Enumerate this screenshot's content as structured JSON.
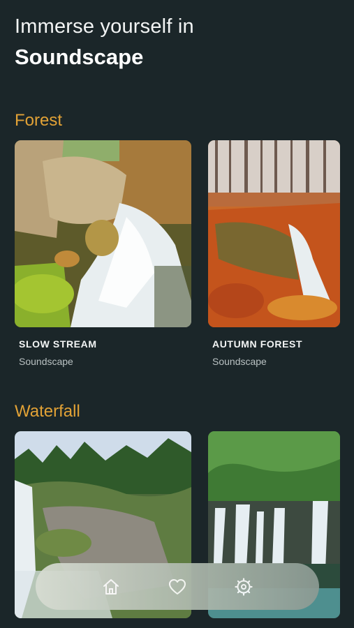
{
  "header": {
    "line1": "Immerse yourself in",
    "line2": "Soundscape"
  },
  "sections": [
    {
      "title": "Forest",
      "cards": [
        {
          "title": "SLOW STREAM",
          "subtitle": "Soundscape"
        },
        {
          "title": "AUTUMN FOREST",
          "subtitle": "Soundscape"
        }
      ]
    },
    {
      "title": "Waterfall",
      "cards": [
        {
          "title": "",
          "subtitle": ""
        },
        {
          "title": "",
          "subtitle": ""
        }
      ]
    }
  ],
  "nav": {
    "items": [
      {
        "icon": "home-icon"
      },
      {
        "icon": "heart-icon"
      },
      {
        "icon": "settings-gear-icon"
      }
    ]
  },
  "colors": {
    "background": "#1b2629",
    "accent": "#e2a236",
    "nav_bar": "#b8c2b5"
  }
}
